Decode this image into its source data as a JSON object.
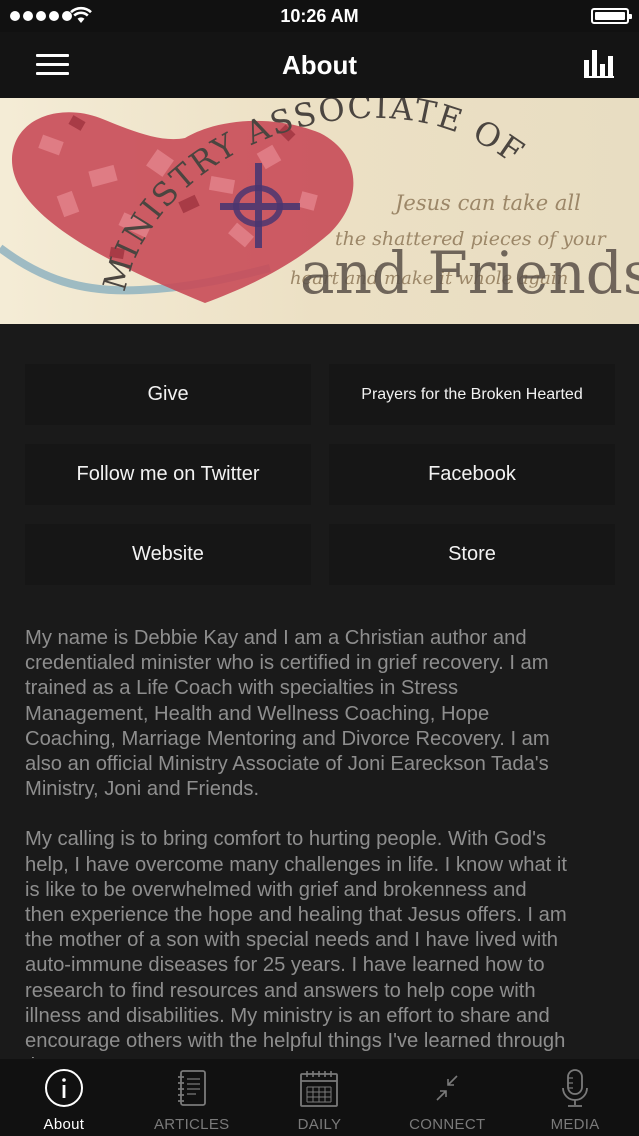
{
  "status_bar": {
    "time": "10:26 AM"
  },
  "nav": {
    "title": "About"
  },
  "banner": {
    "line1": "MINISTRY ASSOCIATE OF",
    "line2": "Jesus can take all",
    "line3": "the shattered pieces of your",
    "line4": "heart and make it whole again",
    "line5": "and Friends"
  },
  "buttons": {
    "give": "Give",
    "prayers": "Prayers for the Broken Hearted",
    "twitter": "Follow me on Twitter",
    "facebook": "Facebook",
    "website": "Website",
    "store": "Store"
  },
  "about": {
    "para1": "My name is Debbie Kay and I am a Christian author and\ncredentialed minister who is certified in grief recovery. I am\ntrained as a Life Coach with specialties in Stress\nManagement, Health and Wellness Coaching, Hope\nCoaching, Marriage Mentoring and Divorce Recovery. I am\nalso an official Ministry Associate of Joni Eareckson Tada's\nMinistry, Joni and Friends.",
    "para2": "My calling is to bring comfort to hurting people.  With God's\nhelp, I have overcome many challenges in life. I know what it\nis like to be overwhelmed with grief and brokenness and\nthen experience the hope and healing that Jesus offers.  I am\nthe mother of a son with special needs and I have lived with\nauto-immune diseases for 25 years. I have learned how to\nresearch to find resources and answers to help cope with\nillness and disabilities. My ministry is an effort to share and\nencourage others with the helpful things I've learned through\nthe process."
  },
  "tabs": [
    {
      "label": "About",
      "icon": "info-icon",
      "active": true
    },
    {
      "label": "ARTICLES",
      "icon": "notebook-icon",
      "active": false
    },
    {
      "label": "DAILY",
      "icon": "calendar-icon",
      "active": false
    },
    {
      "label": "CONNECT",
      "icon": "connect-arrows-icon",
      "active": false
    },
    {
      "label": "MEDIA",
      "icon": "microphone-icon",
      "active": false
    }
  ],
  "colors": {
    "background": "#1a1a1a",
    "button_bg": "#161616",
    "body_text": "#8e8e8e",
    "heart_red": "#c84b58",
    "banner_bg": "#f1e7cf"
  }
}
